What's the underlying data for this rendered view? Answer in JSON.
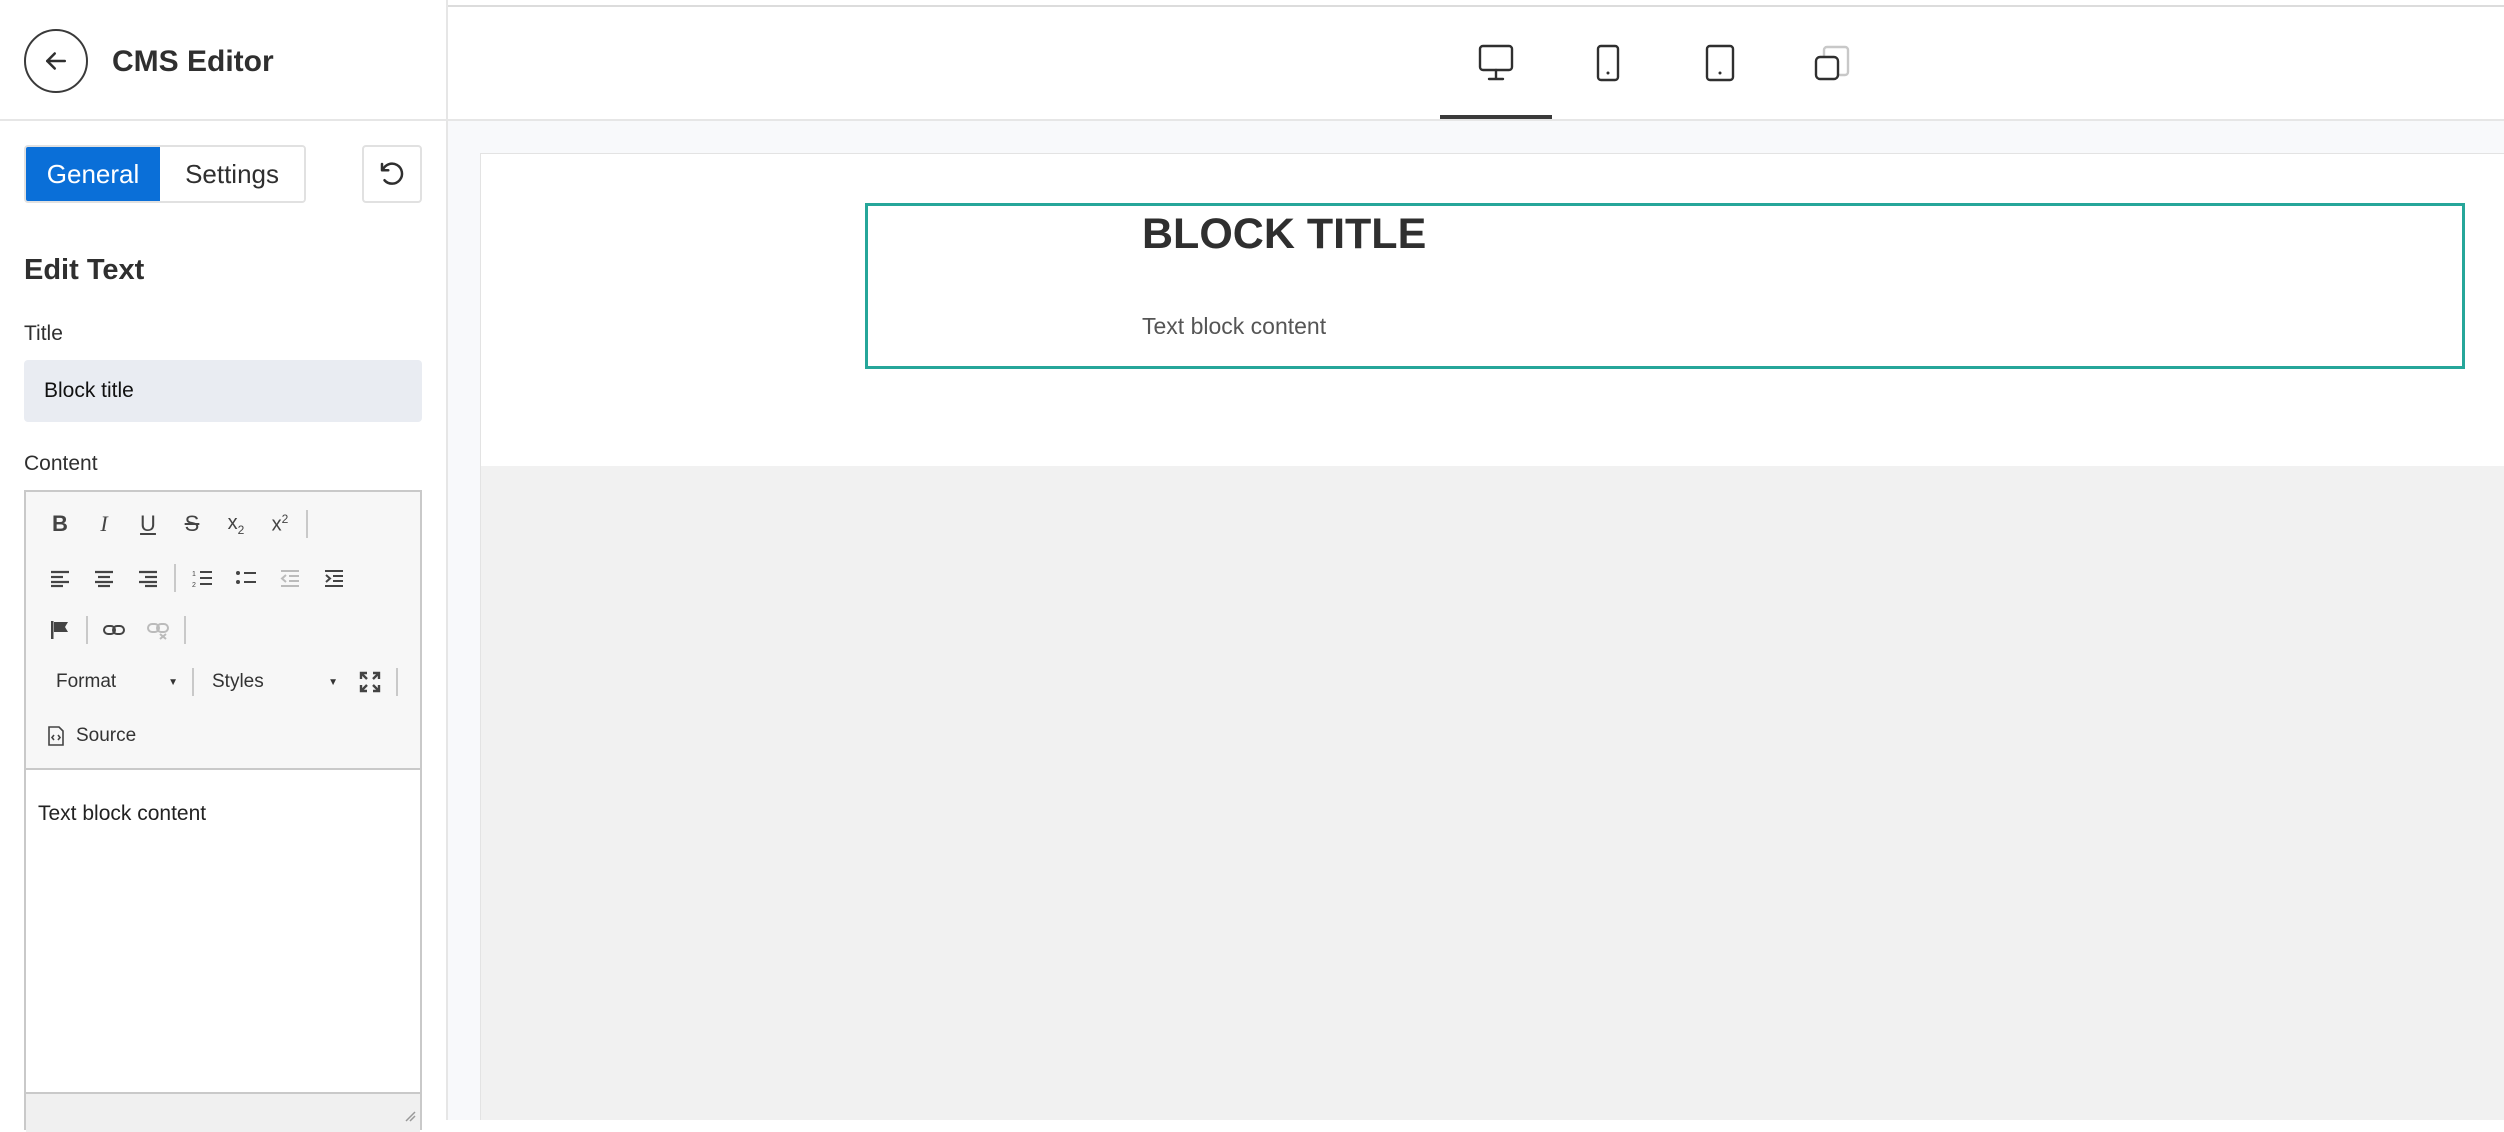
{
  "app": {
    "title": "CMS Editor"
  },
  "tabs": [
    {
      "label": "General",
      "active": true
    },
    {
      "label": "Settings",
      "active": false
    }
  ],
  "panel": {
    "section_title": "Edit Text",
    "title_label": "Title",
    "title_value": "Block title",
    "content_label": "Content"
  },
  "editor": {
    "toolbar": {
      "row1": [
        "bold-icon",
        "italic-icon",
        "underline-icon",
        "strikethrough-icon",
        "subscript-icon",
        "superscript-icon"
      ],
      "row2": [
        "align-left-icon",
        "align-center-icon",
        "align-right-icon",
        "numbered-list-icon",
        "bulleted-list-icon",
        "outdent-icon",
        "indent-icon"
      ],
      "row3": [
        "flag-icon",
        "link-icon",
        "unlink-icon"
      ],
      "format_label": "Format",
      "styles_label": "Styles",
      "source_label": "Source"
    },
    "content": "Text block content"
  },
  "devices": [
    {
      "name": "desktop-icon",
      "active": true
    },
    {
      "name": "mobile-icon",
      "active": false
    },
    {
      "name": "tablet-icon",
      "active": false
    },
    {
      "name": "responsive-icon",
      "active": false
    }
  ],
  "preview": {
    "block_title": "BLOCK TITLE",
    "block_text": "Text block content"
  },
  "colors": {
    "primary": "#0a6fd8",
    "selection": "#26a69a"
  }
}
